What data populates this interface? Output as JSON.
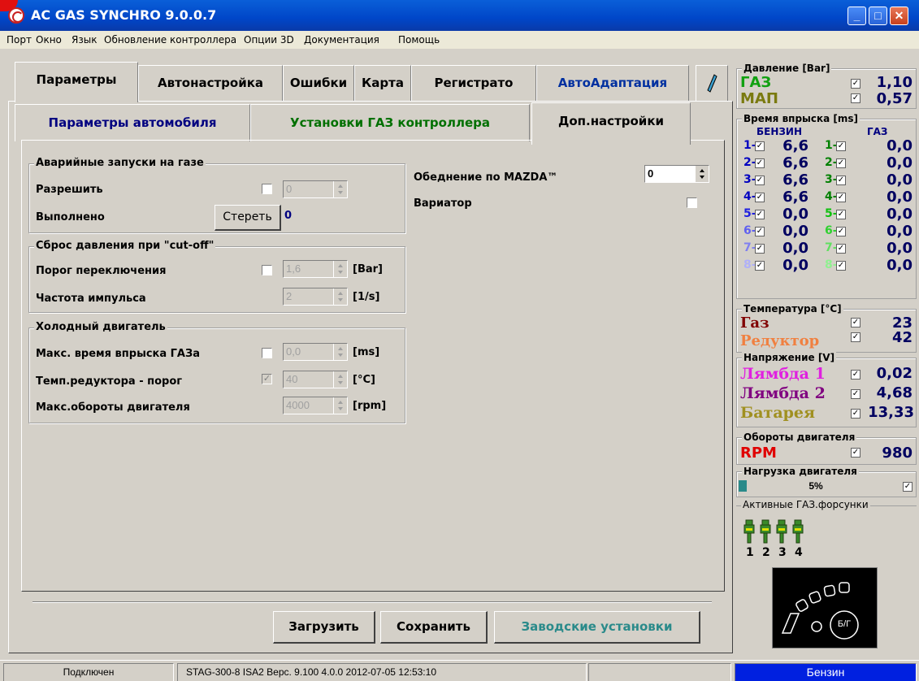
{
  "window": {
    "title": "AC GAS SYNCHRO  9.0.0.7"
  },
  "menu": [
    "Порт",
    "Окно",
    "Язык",
    "Обновление контроллера",
    "Опции 3D",
    "Документация",
    "Помощь"
  ],
  "tabs": [
    "Параметры",
    "Автонастройка",
    "Ошибки",
    "Карта",
    "Регистрато",
    "АвтоАдаптация"
  ],
  "subtabs": [
    "Параметры автомобиля",
    "Установки ГАЗ контроллера",
    "Доп.настройки"
  ],
  "groups": {
    "emergency": {
      "title": "Аварийные запуски на газе",
      "allow": "Разрешить",
      "allow_val": "0",
      "done": "Выполнено",
      "erase": "Стереть",
      "done_val": "0"
    },
    "cutoff": {
      "title": "Сброс давления при \"cut-off\"",
      "threshold": "Порог переключения",
      "threshold_val": "1,6",
      "threshold_unit": "[Bar]",
      "freq": "Частота импульса",
      "freq_val": "2",
      "freq_unit": "[1/s]"
    },
    "cold": {
      "title": "Холодный двигатель",
      "maxinj": "Макс. время впрыска ГАЗа",
      "maxinj_val": "0,0",
      "maxinj_unit": "[ms]",
      "redtemp": "Темп.редуктора - порог",
      "redtemp_val": "40",
      "redtemp_unit": "[°C]",
      "maxrpm": "Макс.обороты двигателя",
      "maxrpm_val": "4000",
      "maxrpm_unit": "[rpm]"
    }
  },
  "right": {
    "mazda": "Обеднение по MAZDA™",
    "mazda_val": "0",
    "variator": "Вариатор"
  },
  "buttons": {
    "load": "Загрузить",
    "save": "Сохранить",
    "factory": "Заводские установки"
  },
  "side": {
    "pressure": {
      "title": "Давление [Bar]",
      "gas": "ГАЗ",
      "gas_val": "1,10",
      "map": "МАП",
      "map_val": "0,57"
    },
    "inj": {
      "title": "Время впрыска [ms]",
      "petrol": "БЕНЗИН",
      "gas": "ГАЗ",
      "rows": [
        {
          "n": "1-",
          "p": "6,6",
          "g": "0,0"
        },
        {
          "n": "2-",
          "p": "6,6",
          "g": "0,0"
        },
        {
          "n": "3-",
          "p": "6,6",
          "g": "0,0"
        },
        {
          "n": "4-",
          "p": "6,6",
          "g": "0,0"
        },
        {
          "n": "5-",
          "p": "0,0",
          "g": "0,0"
        },
        {
          "n": "6-",
          "p": "0,0",
          "g": "0,0"
        },
        {
          "n": "7-",
          "p": "0,0",
          "g": "0,0"
        },
        {
          "n": "8-",
          "p": "0,0",
          "g": "0,0"
        }
      ]
    },
    "temp": {
      "title": "Температура  [°C]",
      "gas": "Газ",
      "gas_val": "23",
      "red": "Редуктор",
      "red_val": "42"
    },
    "volt": {
      "title": "Напряжение [V]",
      "l1": "Лямбда 1",
      "l1_val": "0,02",
      "l2": "Лямбда 2",
      "l2_val": "4,68",
      "bat": "Батарея",
      "bat_val": "13,33"
    },
    "rpm": {
      "title": "Обороты двигателя",
      "label": "RPM",
      "val": "980"
    },
    "load": {
      "title": "Нагрузка двигателя",
      "val": "5%",
      "fraction": 0.05
    },
    "active": {
      "title": "Активные ГАЗ.форсунки",
      "nums": [
        "1",
        "2",
        "3",
        "4"
      ]
    },
    "switch": "Б/Г"
  },
  "status": {
    "conn": "Подключен",
    "info": "STAG-300-8 ISA2  Верс. 9.100  4.0.0    2012-07-05 12:53:10",
    "fuel": "Бензин"
  },
  "colors": {
    "title": "#0046c8",
    "tab_green": "#007000",
    "tab_blue": "#000080",
    "teal": "#2a8a8a"
  }
}
